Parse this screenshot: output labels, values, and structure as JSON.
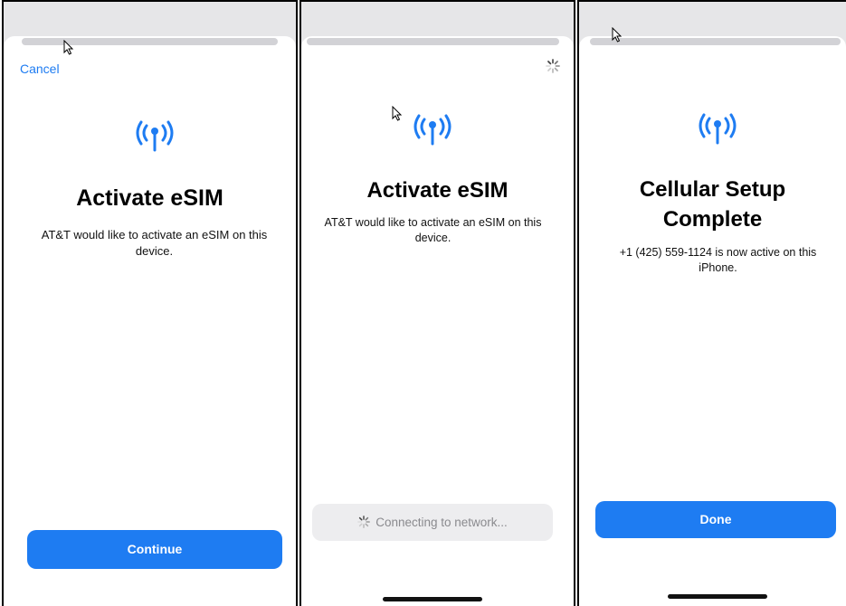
{
  "screens": [
    {
      "cancel_label": "Cancel",
      "icon": "cellular-antenna-icon",
      "title": "Activate eSIM",
      "description": "AT&T would like to activate an eSIM on this device.",
      "button_label": "Continue"
    },
    {
      "icon": "cellular-antenna-icon",
      "title": "Activate eSIM",
      "description": "AT&T would like to activate an eSIM on this device.",
      "status_label": "Connecting to network...",
      "status_icon": "loading-spinner-icon"
    },
    {
      "icon": "cellular-antenna-icon",
      "title_line1": "Cellular Setup",
      "title_line2": "Complete",
      "description": "+1 (425) 559-1124 is now active on this iPhone.",
      "button_label": "Done"
    }
  ],
  "colors": {
    "accent": "#1e7cf2",
    "disabled_button_bg": "#ededef",
    "disabled_text": "#8a8a8e",
    "sheet_background": "#e6e6e8"
  }
}
